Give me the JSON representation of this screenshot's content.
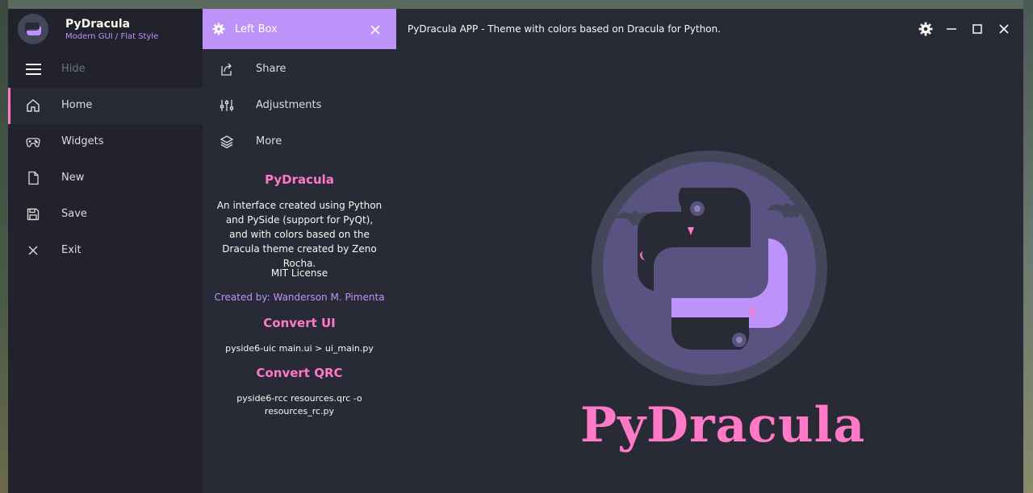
{
  "app": {
    "title": "PyDracula",
    "subtitle": "Modern GUI / Flat Style",
    "description": "PyDracula APP - Theme with colors based on Dracula for Python."
  },
  "colors": {
    "accent_purple": "#bd93f9",
    "accent_pink": "#ff79c6",
    "bg_dark": "#21222c",
    "bg_main": "#282a36"
  },
  "left_menu": {
    "toggle_label": "Hide",
    "items": [
      {
        "label": "Home",
        "icon": "home-icon"
      },
      {
        "label": "Widgets",
        "icon": "gamepad-icon"
      },
      {
        "label": "New",
        "icon": "file-icon"
      },
      {
        "label": "Save",
        "icon": "save-icon"
      },
      {
        "label": "Exit",
        "icon": "x-icon"
      }
    ]
  },
  "left_box": {
    "title": "Left Box",
    "items": [
      {
        "label": "Share",
        "icon": "share-icon"
      },
      {
        "label": "Adjustments",
        "icon": "sliders-icon"
      },
      {
        "label": "More",
        "icon": "layers-icon"
      }
    ],
    "info_title": "PyDracula",
    "info_body": "An interface created using Python and PySide (support for PyQt), and with colors based on the Dracula theme created by Zeno Rocha.",
    "license": "MIT License",
    "created_by": "Created by: Wanderson M. Pimenta",
    "convert_ui_title": "Convert UI",
    "convert_ui_cmd": "pyside6-uic main.ui > ui_main.py",
    "convert_qrc_title": "Convert QRC",
    "convert_qrc_cmd": "pyside6-rcc resources.qrc -o resources_rc.py"
  },
  "content": {
    "logo_title": "PyDracula"
  }
}
